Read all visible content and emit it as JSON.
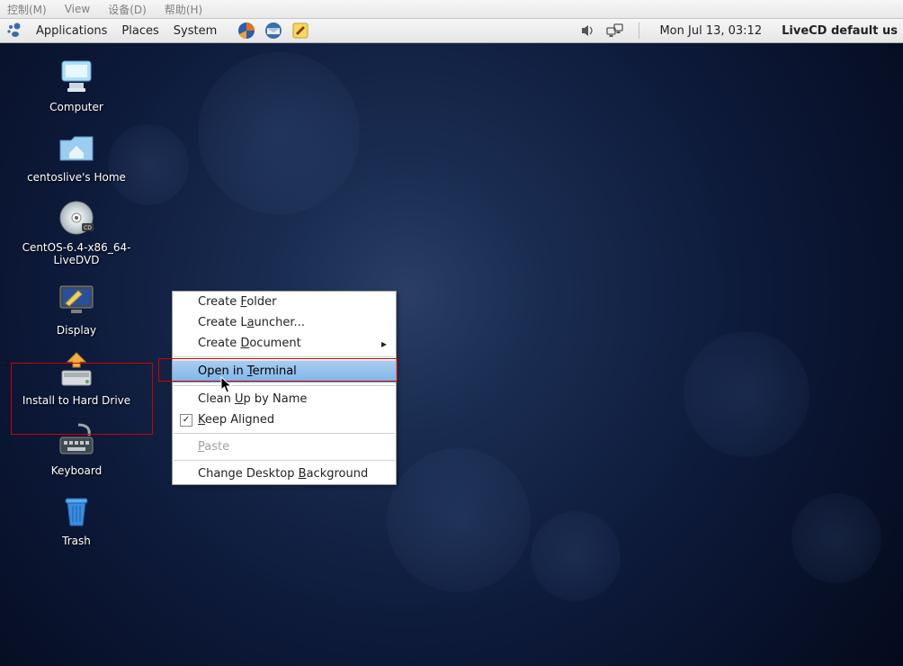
{
  "vm_menu": {
    "control": "控制(M)",
    "view": "View",
    "devices": "设备(D)",
    "help": "帮助(H)"
  },
  "panel": {
    "applications": "Applications",
    "places": "Places",
    "system": "System",
    "clock": "Mon Jul 13, 03:12",
    "user": "LiveCD default us"
  },
  "desktop_icons": {
    "computer": "Computer",
    "home": "centoslive's Home",
    "dvd": "CentOS-6.4-x86_64-LiveDVD",
    "display": "Display",
    "install": "Install to Hard Drive",
    "keyboard": "Keyboard",
    "trash": "Trash"
  },
  "context_menu": {
    "create_folder_pre": "Create ",
    "create_folder_u": "F",
    "create_folder_post": "older",
    "create_launcher_pre": "Create L",
    "create_launcher_u": "a",
    "create_launcher_post": "uncher...",
    "create_document_pre": "Create ",
    "create_document_u": "D",
    "create_document_post": "ocument",
    "open_terminal_pre": "Open in ",
    "open_terminal_u": "T",
    "open_terminal_post": "erminal",
    "cleanup_pre": "Clean ",
    "cleanup_u": "U",
    "cleanup_post": "p by Name",
    "keep_aligned_pre": "",
    "keep_aligned_u": "K",
    "keep_aligned_post": "eep Aligned",
    "paste_pre": "",
    "paste_u": "P",
    "paste_post": "aste",
    "change_bg_pre": "Change Desktop ",
    "change_bg_u": "B",
    "change_bg_post": "ackground"
  }
}
